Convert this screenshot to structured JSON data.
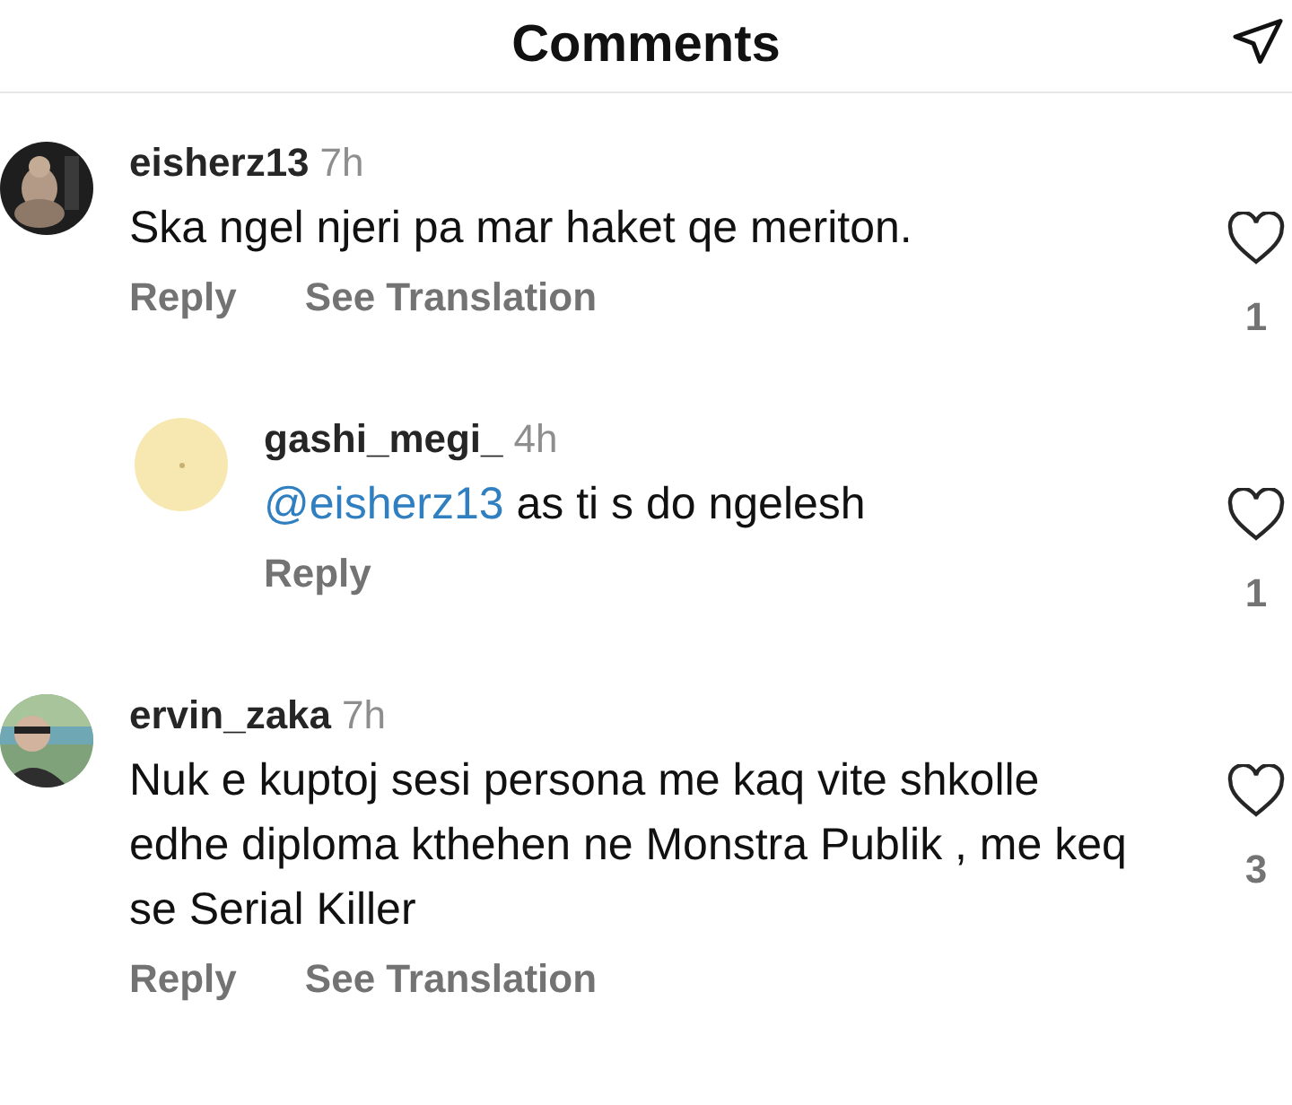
{
  "header": {
    "title": "Comments"
  },
  "comments": [
    {
      "username": "eisherz13",
      "time": "7h",
      "avatar": {
        "kind": "picture"
      },
      "text": "Ska ngel njeri pa mar haket qe meriton.",
      "actions": [
        "Reply",
        "See Translation"
      ],
      "likes": "1",
      "replies": [
        {
          "username": "gashi_megi_",
          "time": "4h",
          "avatar": {
            "kind": "plain"
          },
          "mention": "@eisherz13",
          "text": "as ti s do ngelesh",
          "actions": [
            "Reply"
          ],
          "likes": "1"
        }
      ]
    },
    {
      "username": "ervin_zaka",
      "time": "7h",
      "avatar": {
        "kind": "picture"
      },
      "text": "Nuk e kuptoj sesi persona me kaq vite shkolle edhe diploma kthehen ne Monstra Publik , me keq se Serial Killer",
      "actions": [
        "Reply",
        "See Translation"
      ],
      "likes": "3"
    }
  ]
}
